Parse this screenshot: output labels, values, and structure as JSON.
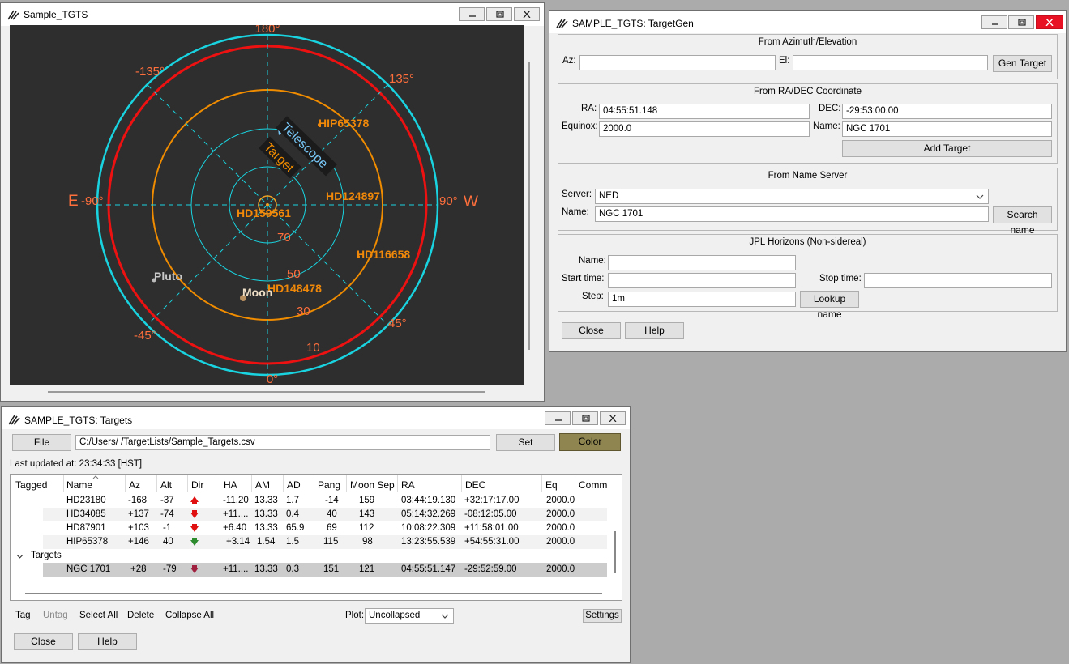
{
  "skymap_window": {
    "title": "Sample_TGTS",
    "az_labels": {
      "north": "180°",
      "south": "0°",
      "east": "-90°",
      "west": "90°",
      "ne": "-135°",
      "nw": "135°",
      "se": "-45°",
      "sw": "45°"
    },
    "cardinal": {
      "east": "E",
      "west": "W"
    },
    "el_labels": [
      "70",
      "50",
      "30",
      "10"
    ],
    "objects": {
      "hip65378": "HIP65378",
      "hd124897": "HD124897",
      "hd159561": "HD159561",
      "hd116658": "HD116658",
      "hd148478": "HD148478",
      "pluto": "Pluto",
      "moon": "Moon",
      "telescope": "Telescope",
      "target": "Target"
    },
    "colors": {
      "background": "#2e2e2e",
      "cyan_ring": "#19d4e0",
      "red_ring": "#ee1111",
      "orange_ring": "#f08c00",
      "labels": "#ff6f3c",
      "star_labels": "#f0880a"
    }
  },
  "targetgen_window": {
    "title": "SAMPLE_TGTS: TargetGen",
    "azel": {
      "title": "From Azimuth/Elevation",
      "az_label": "Az:",
      "az_value": "",
      "el_label": "El:",
      "el_value": "",
      "gen_button": "Gen Target"
    },
    "radec": {
      "title": "From RA/DEC Coordinate",
      "ra_label": "RA:",
      "ra_value": "04:55:51.148",
      "dec_label": "DEC:",
      "dec_value": "-29:53:00.00",
      "equinox_label": "Equinox:",
      "equinox_value": "2000.0",
      "name_label": "Name:",
      "name_value": "NGC 1701",
      "add_button": "Add Target"
    },
    "nameserver": {
      "title": "From Name Server",
      "server_label": "Server:",
      "server_value": "NED",
      "name_label": "Name:",
      "name_value": "NGC 1701",
      "search_button": "Search name"
    },
    "jpl": {
      "title": "JPL Horizons (Non-sidereal)",
      "name_label": "Name:",
      "name_value": "",
      "start_label": "Start time:",
      "start_value": "",
      "stop_label": "Stop time:",
      "stop_value": "",
      "step_label": "Step:",
      "step_value": "1m",
      "lookup_button": "Lookup name"
    },
    "close_button": "Close",
    "help_button": "Help"
  },
  "targets_window": {
    "title": "SAMPLE_TGTS: Targets",
    "file_button": "File",
    "file_path": "C:/Users/      /TargetLists/Sample_Targets.csv",
    "set_button": "Set",
    "color_button": "Color",
    "last_updated": "Last updated at: 23:34:33 [HST]",
    "columns": [
      "Tagged",
      "Name",
      "Az",
      "Alt",
      "Dir",
      "HA",
      "AM",
      "AD",
      "Pang",
      "Moon Sep",
      "RA",
      "DEC",
      "Eq",
      "Comm"
    ],
    "rows": [
      {
        "name": "HD23180",
        "az": "-168",
        "alt": "-37",
        "dir": "up",
        "ha": "-11.20",
        "am": "13.33",
        "ad": "1.7",
        "pang": "-14",
        "moonsep": "159",
        "ra": "03:44:19.130",
        "dec": "+32:17:17.00",
        "eq": "2000.0"
      },
      {
        "name": "HD34085",
        "az": "+137",
        "alt": "-74",
        "dir": "down",
        "ha": "+11....",
        "am": "13.33",
        "ad": "0.4",
        "pang": "40",
        "moonsep": "143",
        "ra": "05:14:32.269",
        "dec": "-08:12:05.00",
        "eq": "2000.0"
      },
      {
        "name": "HD87901",
        "az": "+103",
        "alt": "-1",
        "dir": "down",
        "ha": "+6.40",
        "am": "13.33",
        "ad": "65.9",
        "pang": "69",
        "moonsep": "112",
        "ra": "10:08:22.309",
        "dec": "+11:58:01.00",
        "eq": "2000.0"
      },
      {
        "name": "HIP65378",
        "az": "+146",
        "alt": "40",
        "dir": "down-green",
        "ha": "+3.14",
        "am": "1.54",
        "ad": "1.5",
        "pang": "115",
        "moonsep": "98",
        "ra": "13:23:55.539",
        "dec": "+54:55:31.00",
        "eq": "2000.0"
      }
    ],
    "group_label": "Targets",
    "group_row": {
      "name": "NGC 1701",
      "az": "+28",
      "alt": "-79",
      "dir": "down",
      "ha": "+11....",
      "am": "13.33",
      "ad": "0.3",
      "pang": "151",
      "moonsep": "121",
      "ra": "04:55:51.147",
      "dec": "-29:52:59.00",
      "eq": "2000.0"
    },
    "actions": {
      "tag": "Tag",
      "untag": "Untag",
      "select_all": "Select All",
      "delete": "Delete",
      "collapse_all": "Collapse All"
    },
    "plot_label": "Plot:",
    "plot_value": "Uncollapsed",
    "settings_button": "Settings",
    "close_button": "Close",
    "help_button": "Help"
  }
}
